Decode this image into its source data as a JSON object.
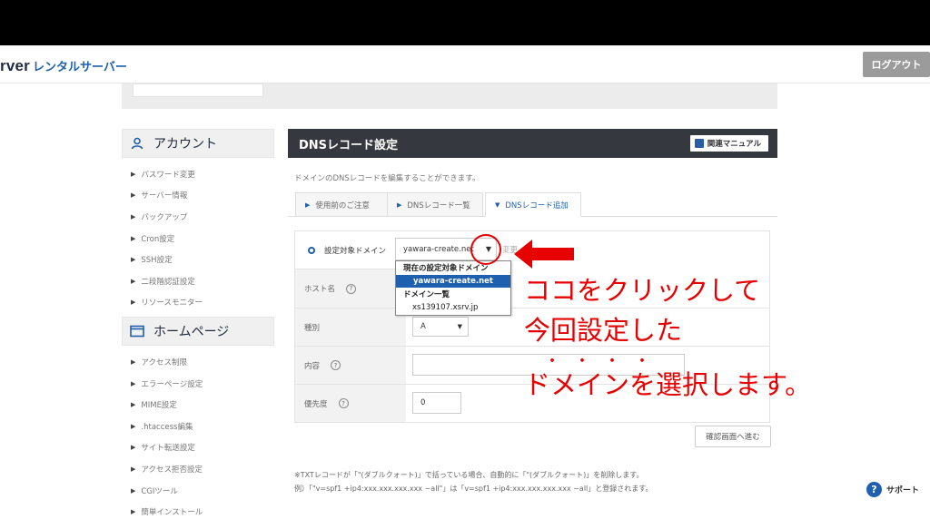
{
  "header": {
    "brand_server": "rver",
    "brand_rental": "レンタルサーバー",
    "logout_label": "ログアウト"
  },
  "sidebar": {
    "account_heading": "アカウント",
    "account_items": [
      {
        "label": "パスワード変更"
      },
      {
        "label": "サーバー情報"
      },
      {
        "label": "バックアップ"
      },
      {
        "label": "Cron設定"
      },
      {
        "label": "SSH設定"
      },
      {
        "label": "二段階認証設定"
      },
      {
        "label": "リソースモニター"
      }
    ],
    "homepage_heading": "ホームページ",
    "homepage_items": [
      {
        "label": "アクセス制限"
      },
      {
        "label": "エラーページ設定"
      },
      {
        "label": "MIME設定"
      },
      {
        "label": ".htaccess編集"
      },
      {
        "label": "サイト転送設定"
      },
      {
        "label": "アクセス拒否設定"
      },
      {
        "label": "CGIツール"
      },
      {
        "label": "簡単インストール"
      }
    ]
  },
  "main": {
    "title": "DNSレコード設定",
    "manual_label": "関連マニュアル",
    "description": "ドメインのDNSレコードを編集することができます。",
    "tabs": [
      {
        "label": "使用前のご注意"
      },
      {
        "label": "DNSレコード一覧"
      },
      {
        "label": "DNSレコード追加"
      }
    ],
    "target_domain_label": "設定対象ドメイン",
    "target_domain_value": "yawara-create.net",
    "change_label": "変更",
    "host_label": "ホスト名",
    "type_label": "種別",
    "type_value": "A",
    "content_label": "内容",
    "priority_label": "優先度",
    "priority_value": "0",
    "confirm_label": "確認画面へ進む",
    "note_line1": "※TXTレコードが「\"(ダブルクォート)」で括っている場合、自動的に「\"(ダブルクォート)」を削除します。",
    "note_line2": "例）「\"v=spf1 +ip4:xxx.xxx.xxx.xxx ~all\"」は「v=spf1 +ip4:xxx.xxx.xxx.xxx ~all」と登録されます。"
  },
  "dropdown": {
    "current_group": "現在の設定対象ドメイン",
    "current_value": "yawara-create.net",
    "list_group": "ドメイン一覧",
    "list_item": "xs139107.xsrv.jp"
  },
  "annotation": {
    "line1": "ココをクリックして",
    "line2": "今回設定した",
    "dots": "・・・・",
    "line3": "ドメインを選択します。",
    "color": "#e60000"
  },
  "support_label": "サポート",
  "colors": {
    "accent_blue": "#1f5fb0",
    "title_bar": "#35393f"
  }
}
